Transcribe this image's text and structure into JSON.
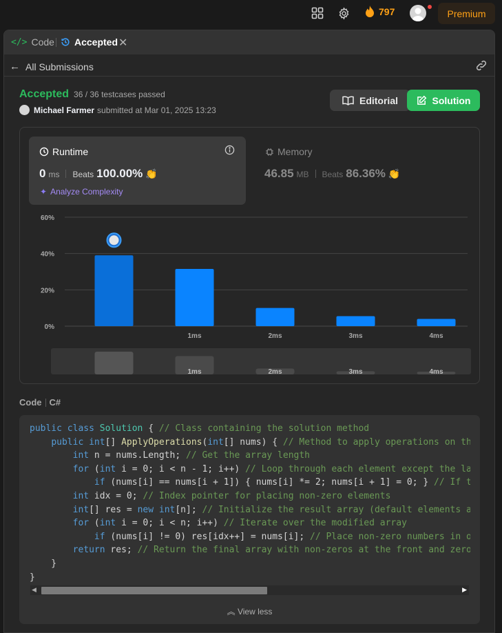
{
  "topbar": {
    "streak_count": "797",
    "premium_label": "Premium"
  },
  "tabs": {
    "code_label": "Code",
    "accepted_label": "Accepted"
  },
  "subbar": {
    "back_label": "All Submissions"
  },
  "submission": {
    "status": "Accepted",
    "testcases": "36 / 36 testcases passed",
    "author": "Michael Farmer",
    "submitted_text": "submitted at Mar 01, 2025 13:23"
  },
  "buttons": {
    "editorial": "Editorial",
    "solution": "Solution"
  },
  "runtime": {
    "title": "Runtime",
    "value": "0",
    "unit": "ms",
    "beats_label": "Beats",
    "beats_value": "100.00%",
    "analyze_label": "Analyze Complexity"
  },
  "memory": {
    "title": "Memory",
    "value": "46.85",
    "unit": "MB",
    "beats_label": "Beats",
    "beats_value": "86.36%"
  },
  "chart_data": {
    "type": "bar",
    "categories": [
      "",
      "1ms",
      "2ms",
      "3ms",
      "4ms"
    ],
    "values": [
      39,
      31.5,
      10,
      5.5,
      4
    ],
    "mini_values": [
      39,
      31.5,
      10,
      5.5,
      4
    ],
    "ylim": [
      0,
      60
    ],
    "yticks": [
      "0%",
      "20%",
      "40%",
      "60%"
    ],
    "grid": true,
    "highlight_index": 0,
    "bar_color": "#0a84ff",
    "highlight_color": "#0a6fd9"
  },
  "code_section": {
    "label": "Code",
    "language": "C#",
    "view_less": "View less"
  },
  "colors": {
    "accent_green": "#2cbb5d",
    "premium_orange": "#ffa116",
    "bar_blue": "#0a84ff"
  }
}
